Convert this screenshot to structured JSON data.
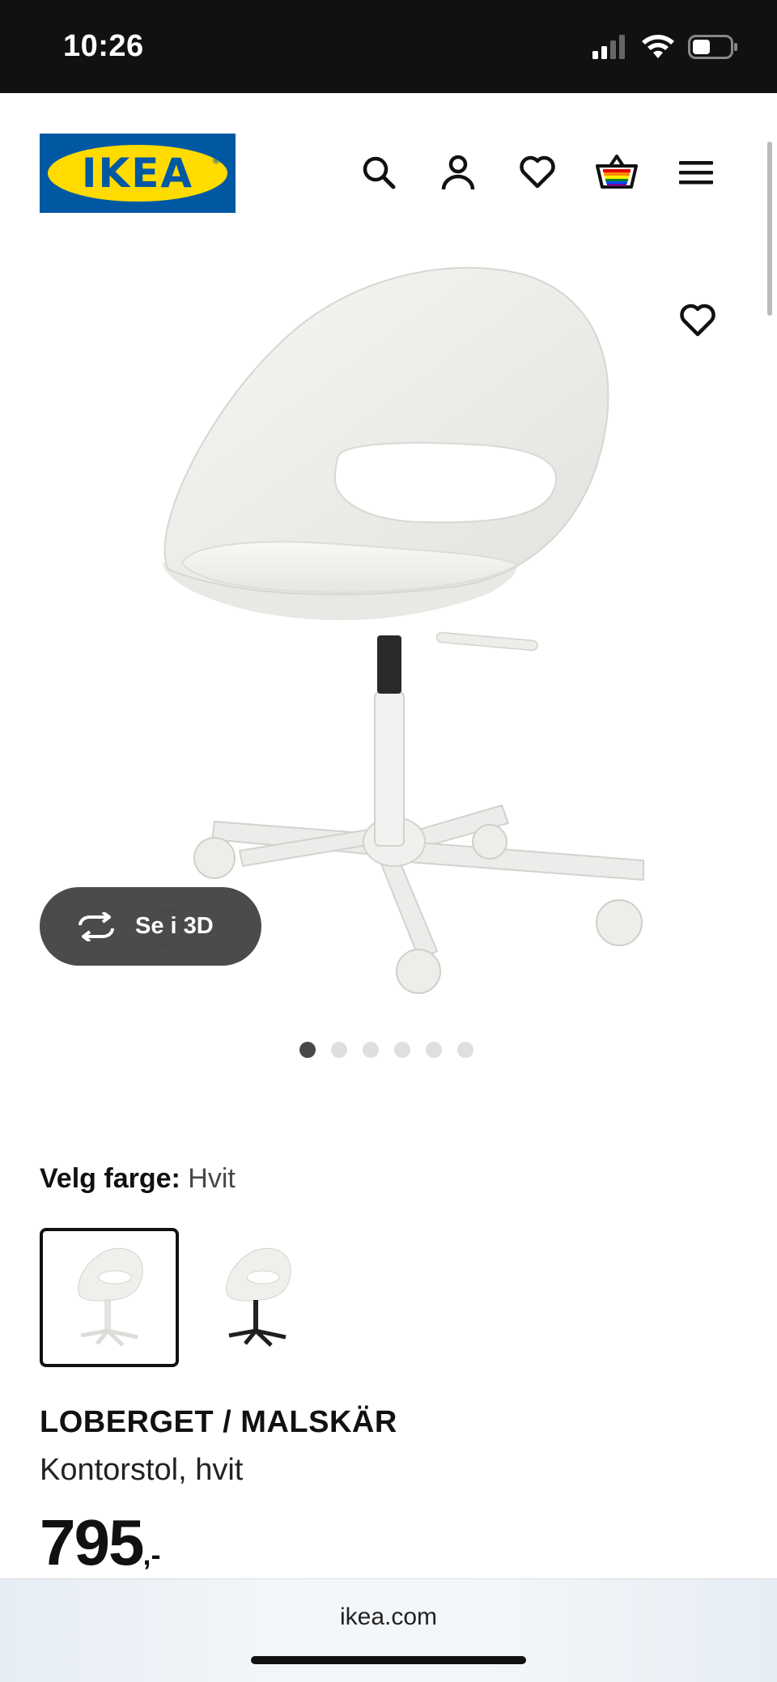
{
  "status_bar": {
    "time": "10:26"
  },
  "header": {
    "logo_text": "IKEA",
    "icons": [
      "search-icon",
      "account-icon",
      "wishlist-icon",
      "cart-icon",
      "menu-icon"
    ]
  },
  "hero": {
    "image_index": 1,
    "image_count": 6,
    "view_3d_label": "Se i 3D"
  },
  "color_picker": {
    "label": "Velg farge:",
    "selected_value": "Hvit",
    "options": [
      "white",
      "black"
    ]
  },
  "product": {
    "name": "LOBERGET / MALSKÄR",
    "description": "Kontorstol, hvit",
    "price": "795",
    "price_suffix": ",-"
  },
  "browser": {
    "url": "ikea.com"
  },
  "colors": {
    "brand_blue": "#0058a3",
    "brand_yellow": "#ffdb00"
  }
}
